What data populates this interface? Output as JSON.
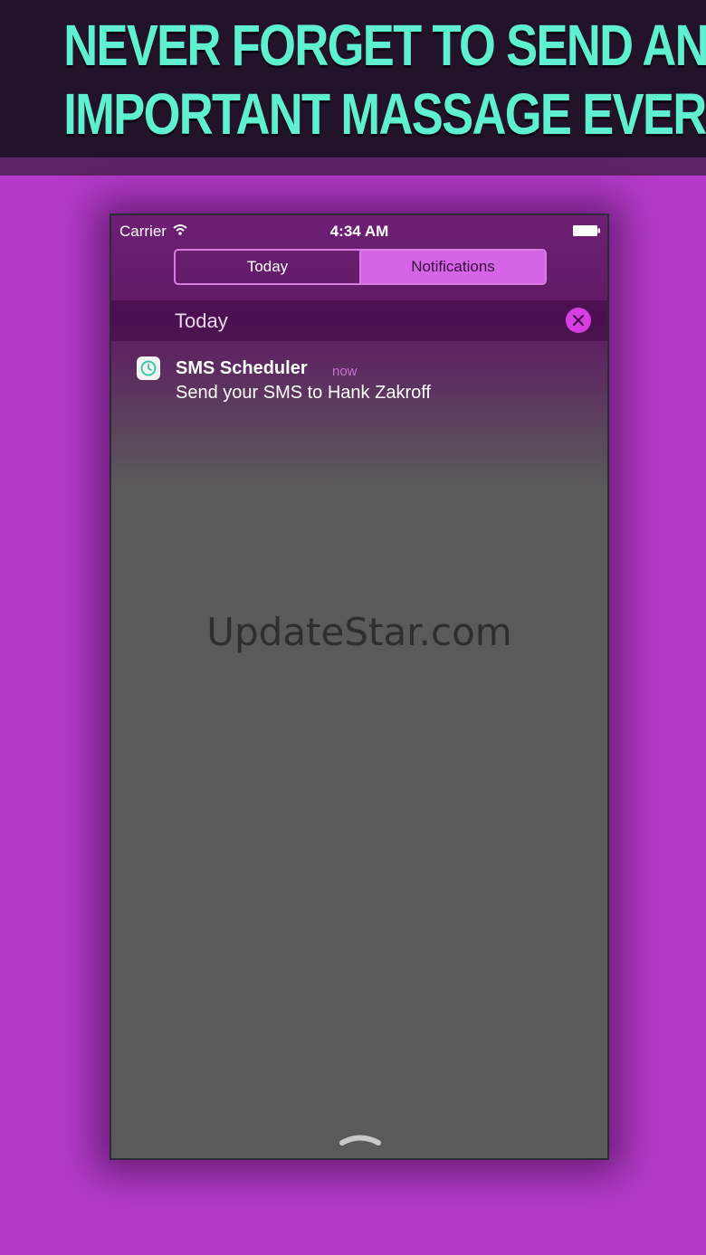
{
  "banner": {
    "line1": "NEVER FORGET TO SEND AN",
    "line2": "IMPORTANT MASSAGE EVER"
  },
  "status_bar": {
    "carrier": "Carrier",
    "time": "4:34 AM"
  },
  "tabs": [
    {
      "label": "Today",
      "active": false
    },
    {
      "label": "Notifications",
      "active": true
    }
  ],
  "section": {
    "title": "Today",
    "clear_icon": "close-icon"
  },
  "notification": {
    "app_name": "SMS Scheduler",
    "time": "now",
    "body": "Send your SMS to Hank Zakroff",
    "icon": "clock-icon"
  },
  "watermark": "UpdateStar.com",
  "colors": {
    "background": "#b23ac6",
    "banner": "#22122a",
    "headline": "#5ff0d2",
    "accent": "#d565e6",
    "phone_body": "#5a5a5a"
  }
}
